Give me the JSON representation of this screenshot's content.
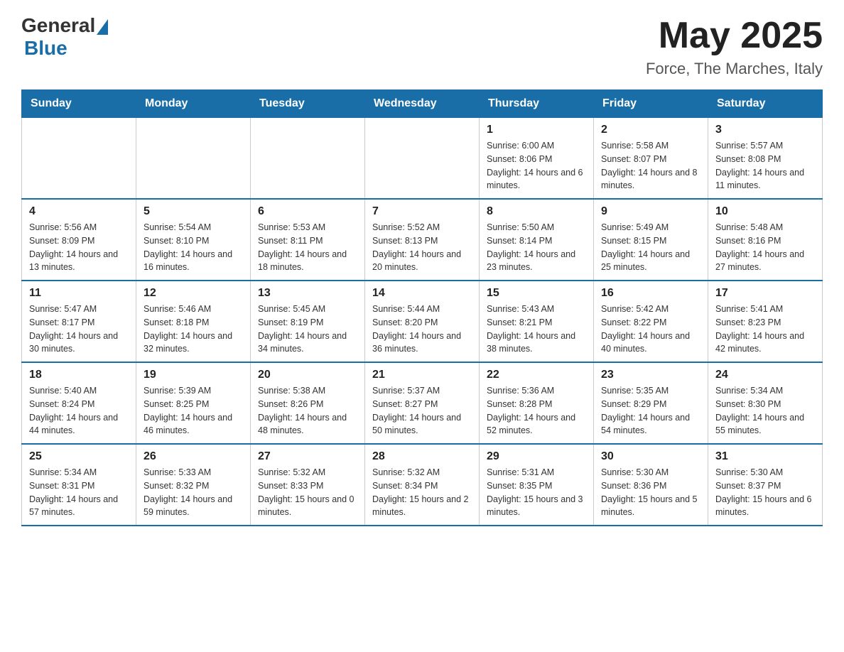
{
  "header": {
    "logo_general": "General",
    "logo_blue": "Blue",
    "month_title": "May 2025",
    "location": "Force, The Marches, Italy"
  },
  "weekdays": [
    "Sunday",
    "Monday",
    "Tuesday",
    "Wednesday",
    "Thursday",
    "Friday",
    "Saturday"
  ],
  "weeks": [
    [
      {
        "day": "",
        "info": ""
      },
      {
        "day": "",
        "info": ""
      },
      {
        "day": "",
        "info": ""
      },
      {
        "day": "",
        "info": ""
      },
      {
        "day": "1",
        "info": "Sunrise: 6:00 AM\nSunset: 8:06 PM\nDaylight: 14 hours and 6 minutes."
      },
      {
        "day": "2",
        "info": "Sunrise: 5:58 AM\nSunset: 8:07 PM\nDaylight: 14 hours and 8 minutes."
      },
      {
        "day": "3",
        "info": "Sunrise: 5:57 AM\nSunset: 8:08 PM\nDaylight: 14 hours and 11 minutes."
      }
    ],
    [
      {
        "day": "4",
        "info": "Sunrise: 5:56 AM\nSunset: 8:09 PM\nDaylight: 14 hours and 13 minutes."
      },
      {
        "day": "5",
        "info": "Sunrise: 5:54 AM\nSunset: 8:10 PM\nDaylight: 14 hours and 16 minutes."
      },
      {
        "day": "6",
        "info": "Sunrise: 5:53 AM\nSunset: 8:11 PM\nDaylight: 14 hours and 18 minutes."
      },
      {
        "day": "7",
        "info": "Sunrise: 5:52 AM\nSunset: 8:13 PM\nDaylight: 14 hours and 20 minutes."
      },
      {
        "day": "8",
        "info": "Sunrise: 5:50 AM\nSunset: 8:14 PM\nDaylight: 14 hours and 23 minutes."
      },
      {
        "day": "9",
        "info": "Sunrise: 5:49 AM\nSunset: 8:15 PM\nDaylight: 14 hours and 25 minutes."
      },
      {
        "day": "10",
        "info": "Sunrise: 5:48 AM\nSunset: 8:16 PM\nDaylight: 14 hours and 27 minutes."
      }
    ],
    [
      {
        "day": "11",
        "info": "Sunrise: 5:47 AM\nSunset: 8:17 PM\nDaylight: 14 hours and 30 minutes."
      },
      {
        "day": "12",
        "info": "Sunrise: 5:46 AM\nSunset: 8:18 PM\nDaylight: 14 hours and 32 minutes."
      },
      {
        "day": "13",
        "info": "Sunrise: 5:45 AM\nSunset: 8:19 PM\nDaylight: 14 hours and 34 minutes."
      },
      {
        "day": "14",
        "info": "Sunrise: 5:44 AM\nSunset: 8:20 PM\nDaylight: 14 hours and 36 minutes."
      },
      {
        "day": "15",
        "info": "Sunrise: 5:43 AM\nSunset: 8:21 PM\nDaylight: 14 hours and 38 minutes."
      },
      {
        "day": "16",
        "info": "Sunrise: 5:42 AM\nSunset: 8:22 PM\nDaylight: 14 hours and 40 minutes."
      },
      {
        "day": "17",
        "info": "Sunrise: 5:41 AM\nSunset: 8:23 PM\nDaylight: 14 hours and 42 minutes."
      }
    ],
    [
      {
        "day": "18",
        "info": "Sunrise: 5:40 AM\nSunset: 8:24 PM\nDaylight: 14 hours and 44 minutes."
      },
      {
        "day": "19",
        "info": "Sunrise: 5:39 AM\nSunset: 8:25 PM\nDaylight: 14 hours and 46 minutes."
      },
      {
        "day": "20",
        "info": "Sunrise: 5:38 AM\nSunset: 8:26 PM\nDaylight: 14 hours and 48 minutes."
      },
      {
        "day": "21",
        "info": "Sunrise: 5:37 AM\nSunset: 8:27 PM\nDaylight: 14 hours and 50 minutes."
      },
      {
        "day": "22",
        "info": "Sunrise: 5:36 AM\nSunset: 8:28 PM\nDaylight: 14 hours and 52 minutes."
      },
      {
        "day": "23",
        "info": "Sunrise: 5:35 AM\nSunset: 8:29 PM\nDaylight: 14 hours and 54 minutes."
      },
      {
        "day": "24",
        "info": "Sunrise: 5:34 AM\nSunset: 8:30 PM\nDaylight: 14 hours and 55 minutes."
      }
    ],
    [
      {
        "day": "25",
        "info": "Sunrise: 5:34 AM\nSunset: 8:31 PM\nDaylight: 14 hours and 57 minutes."
      },
      {
        "day": "26",
        "info": "Sunrise: 5:33 AM\nSunset: 8:32 PM\nDaylight: 14 hours and 59 minutes."
      },
      {
        "day": "27",
        "info": "Sunrise: 5:32 AM\nSunset: 8:33 PM\nDaylight: 15 hours and 0 minutes."
      },
      {
        "day": "28",
        "info": "Sunrise: 5:32 AM\nSunset: 8:34 PM\nDaylight: 15 hours and 2 minutes."
      },
      {
        "day": "29",
        "info": "Sunrise: 5:31 AM\nSunset: 8:35 PM\nDaylight: 15 hours and 3 minutes."
      },
      {
        "day": "30",
        "info": "Sunrise: 5:30 AM\nSunset: 8:36 PM\nDaylight: 15 hours and 5 minutes."
      },
      {
        "day": "31",
        "info": "Sunrise: 5:30 AM\nSunset: 8:37 PM\nDaylight: 15 hours and 6 minutes."
      }
    ]
  ]
}
